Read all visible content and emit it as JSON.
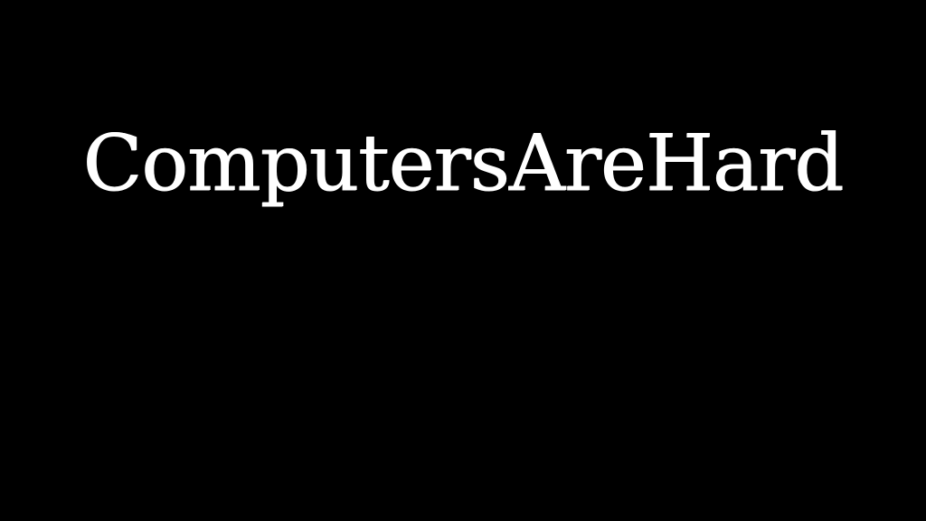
{
  "slide": {
    "title": "ComputersAreHard",
    "background_color": "#000000",
    "text_color": "#ffffff"
  }
}
